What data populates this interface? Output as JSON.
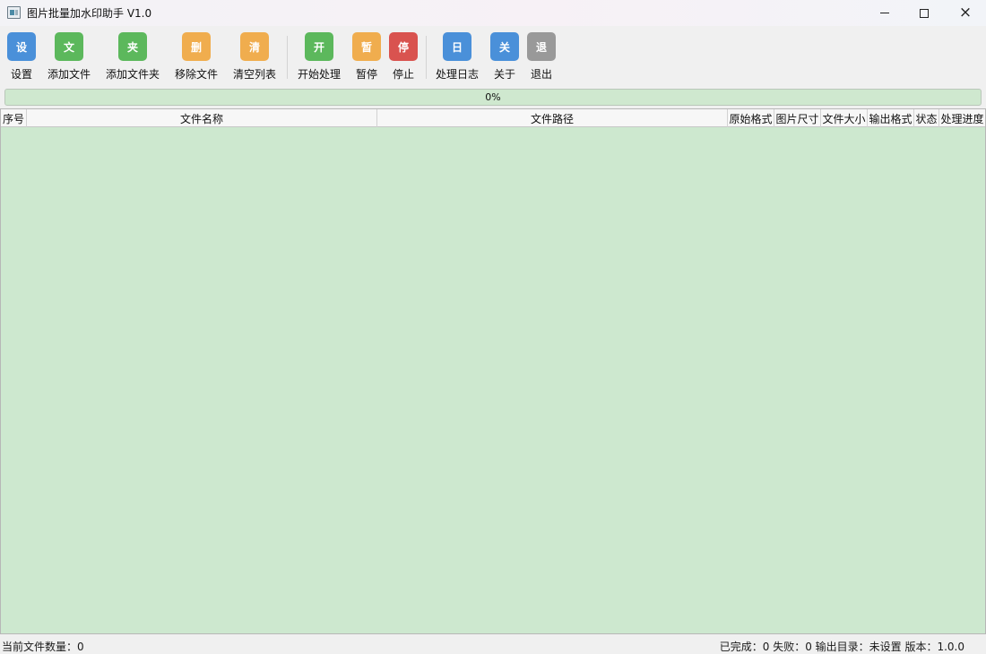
{
  "window": {
    "title": "图片批量加水印助手 V1.0",
    "app_icon": "image-app-icon",
    "controls": {
      "minimize": "minimize-icon",
      "maximize": "maximize-icon",
      "close": "×"
    }
  },
  "toolbar": {
    "items": [
      {
        "key": "settings",
        "glyph": "设",
        "label": "设置",
        "color": "#4a90d9"
      },
      {
        "key": "add-file",
        "glyph": "文",
        "label": "添加文件",
        "color": "#5cb85c"
      },
      {
        "key": "add-folder",
        "glyph": "夹",
        "label": "添加文件夹",
        "color": "#5cb85c"
      },
      {
        "key": "remove-file",
        "glyph": "删",
        "label": "移除文件",
        "color": "#f0ad4e"
      },
      {
        "key": "clear-list",
        "glyph": "清",
        "label": "清空列表",
        "color": "#f0ad4e"
      },
      {
        "key": "start",
        "glyph": "开",
        "label": "开始处理",
        "color": "#5cb85c"
      },
      {
        "key": "pause",
        "glyph": "暂",
        "label": "暂停",
        "color": "#f0ad4e"
      },
      {
        "key": "stop",
        "glyph": "停",
        "label": "停止",
        "color": "#d9534f"
      },
      {
        "key": "log",
        "glyph": "日",
        "label": "处理日志",
        "color": "#4a90d9"
      },
      {
        "key": "about",
        "glyph": "关",
        "label": "关于",
        "color": "#4a90d9"
      },
      {
        "key": "exit",
        "glyph": "退",
        "label": "退出",
        "color": "#999999"
      }
    ]
  },
  "progress": {
    "value": 0,
    "text": "0%",
    "fill_color": "#06b025"
  },
  "table": {
    "columns": [
      "序号",
      "文件名称",
      "文件路径",
      "原始格式",
      "图片尺寸",
      "文件大小",
      "输出格式",
      "状态",
      "处理进度"
    ],
    "rows": [],
    "background": "#cde8cf"
  },
  "status": {
    "file_count": "当前文件数量：0",
    "right": "已完成：0  失败：0  输出目录：未设置  版本：1.0.0"
  }
}
